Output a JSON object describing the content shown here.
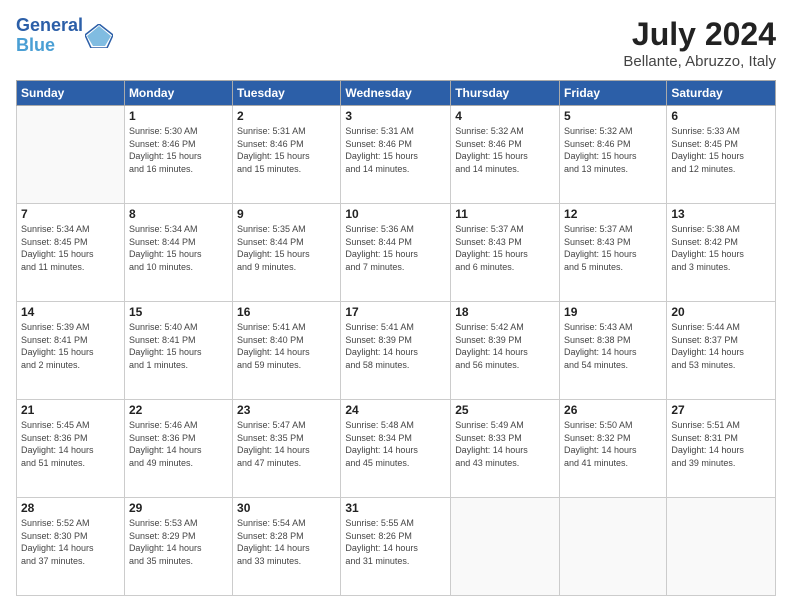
{
  "header": {
    "logo_line1": "General",
    "logo_line2": "Blue",
    "title": "July 2024",
    "subtitle": "Bellante, Abruzzo, Italy"
  },
  "weekdays": [
    "Sunday",
    "Monday",
    "Tuesday",
    "Wednesday",
    "Thursday",
    "Friday",
    "Saturday"
  ],
  "weeks": [
    [
      {
        "day": "",
        "sunrise": "",
        "sunset": "",
        "daylight": ""
      },
      {
        "day": "1",
        "sunrise": "5:30 AM",
        "sunset": "8:46 PM",
        "daylight": "15 hours and 16 minutes."
      },
      {
        "day": "2",
        "sunrise": "5:31 AM",
        "sunset": "8:46 PM",
        "daylight": "15 hours and 15 minutes."
      },
      {
        "day": "3",
        "sunrise": "5:31 AM",
        "sunset": "8:46 PM",
        "daylight": "15 hours and 14 minutes."
      },
      {
        "day": "4",
        "sunrise": "5:32 AM",
        "sunset": "8:46 PM",
        "daylight": "15 hours and 14 minutes."
      },
      {
        "day": "5",
        "sunrise": "5:32 AM",
        "sunset": "8:46 PM",
        "daylight": "15 hours and 13 minutes."
      },
      {
        "day": "6",
        "sunrise": "5:33 AM",
        "sunset": "8:45 PM",
        "daylight": "15 hours and 12 minutes."
      }
    ],
    [
      {
        "day": "7",
        "sunrise": "5:34 AM",
        "sunset": "8:45 PM",
        "daylight": "15 hours and 11 minutes."
      },
      {
        "day": "8",
        "sunrise": "5:34 AM",
        "sunset": "8:44 PM",
        "daylight": "15 hours and 10 minutes."
      },
      {
        "day": "9",
        "sunrise": "5:35 AM",
        "sunset": "8:44 PM",
        "daylight": "15 hours and 9 minutes."
      },
      {
        "day": "10",
        "sunrise": "5:36 AM",
        "sunset": "8:44 PM",
        "daylight": "15 hours and 7 minutes."
      },
      {
        "day": "11",
        "sunrise": "5:37 AM",
        "sunset": "8:43 PM",
        "daylight": "15 hours and 6 minutes."
      },
      {
        "day": "12",
        "sunrise": "5:37 AM",
        "sunset": "8:43 PM",
        "daylight": "15 hours and 5 minutes."
      },
      {
        "day": "13",
        "sunrise": "5:38 AM",
        "sunset": "8:42 PM",
        "daylight": "15 hours and 3 minutes."
      }
    ],
    [
      {
        "day": "14",
        "sunrise": "5:39 AM",
        "sunset": "8:41 PM",
        "daylight": "15 hours and 2 minutes."
      },
      {
        "day": "15",
        "sunrise": "5:40 AM",
        "sunset": "8:41 PM",
        "daylight": "15 hours and 1 minute."
      },
      {
        "day": "16",
        "sunrise": "5:41 AM",
        "sunset": "8:40 PM",
        "daylight": "14 hours and 59 minutes."
      },
      {
        "day": "17",
        "sunrise": "5:41 AM",
        "sunset": "8:39 PM",
        "daylight": "14 hours and 58 minutes."
      },
      {
        "day": "18",
        "sunrise": "5:42 AM",
        "sunset": "8:39 PM",
        "daylight": "14 hours and 56 minutes."
      },
      {
        "day": "19",
        "sunrise": "5:43 AM",
        "sunset": "8:38 PM",
        "daylight": "14 hours and 54 minutes."
      },
      {
        "day": "20",
        "sunrise": "5:44 AM",
        "sunset": "8:37 PM",
        "daylight": "14 hours and 53 minutes."
      }
    ],
    [
      {
        "day": "21",
        "sunrise": "5:45 AM",
        "sunset": "8:36 PM",
        "daylight": "14 hours and 51 minutes."
      },
      {
        "day": "22",
        "sunrise": "5:46 AM",
        "sunset": "8:36 PM",
        "daylight": "14 hours and 49 minutes."
      },
      {
        "day": "23",
        "sunrise": "5:47 AM",
        "sunset": "8:35 PM",
        "daylight": "14 hours and 47 minutes."
      },
      {
        "day": "24",
        "sunrise": "5:48 AM",
        "sunset": "8:34 PM",
        "daylight": "14 hours and 45 minutes."
      },
      {
        "day": "25",
        "sunrise": "5:49 AM",
        "sunset": "8:33 PM",
        "daylight": "14 hours and 43 minutes."
      },
      {
        "day": "26",
        "sunrise": "5:50 AM",
        "sunset": "8:32 PM",
        "daylight": "14 hours and 41 minutes."
      },
      {
        "day": "27",
        "sunrise": "5:51 AM",
        "sunset": "8:31 PM",
        "daylight": "14 hours and 39 minutes."
      }
    ],
    [
      {
        "day": "28",
        "sunrise": "5:52 AM",
        "sunset": "8:30 PM",
        "daylight": "14 hours and 37 minutes."
      },
      {
        "day": "29",
        "sunrise": "5:53 AM",
        "sunset": "8:29 PM",
        "daylight": "14 hours and 35 minutes."
      },
      {
        "day": "30",
        "sunrise": "5:54 AM",
        "sunset": "8:28 PM",
        "daylight": "14 hours and 33 minutes."
      },
      {
        "day": "31",
        "sunrise": "5:55 AM",
        "sunset": "8:26 PM",
        "daylight": "14 hours and 31 minutes."
      },
      {
        "day": "",
        "sunrise": "",
        "sunset": "",
        "daylight": ""
      },
      {
        "day": "",
        "sunrise": "",
        "sunset": "",
        "daylight": ""
      },
      {
        "day": "",
        "sunrise": "",
        "sunset": "",
        "daylight": ""
      }
    ]
  ],
  "labels": {
    "sunrise": "Sunrise:",
    "sunset": "Sunset:",
    "daylight": "Daylight:"
  }
}
